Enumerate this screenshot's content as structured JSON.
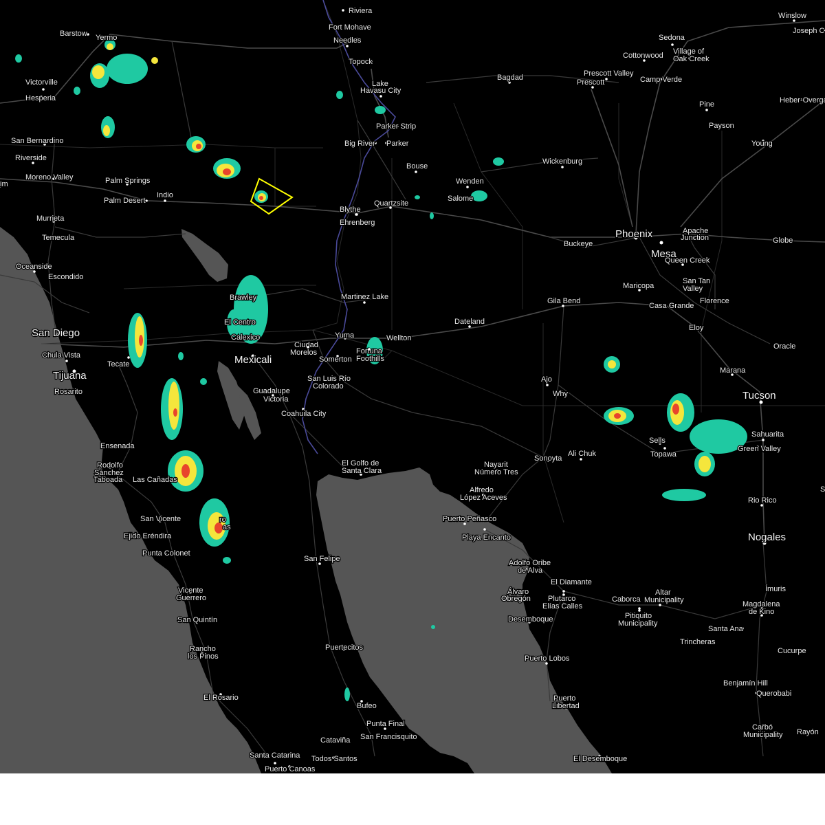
{
  "map": {
    "colors": {
      "land": "#000000",
      "water": "#555555",
      "road": "#3a3a3a",
      "river": "#4a4a9a",
      "warning_polygon": "#ffff00",
      "radar_light": "#1fc9a2",
      "radar_moderate": "#f5e63c",
      "radar_heavy": "#e8452c",
      "footer": "#ffffff"
    },
    "cities": [
      {
        "name": "Riviera",
        "major": false
      },
      {
        "name": "Fort Mohave",
        "major": false
      },
      {
        "name": "Needles",
        "major": false
      },
      {
        "name": "Topock",
        "major": false
      },
      {
        "name": "Lake",
        "major": false
      },
      {
        "name": "Havasu City",
        "major": false
      },
      {
        "name": "Parker Strip",
        "major": false
      },
      {
        "name": "Big River",
        "major": false
      },
      {
        "name": "Parker",
        "major": false
      },
      {
        "name": "Bouse",
        "major": false
      },
      {
        "name": "Quartzsite",
        "major": false
      },
      {
        "name": "Blythe",
        "major": false
      },
      {
        "name": "Ehrenberg",
        "major": false
      },
      {
        "name": "Barstow",
        "major": false
      },
      {
        "name": "Yermo",
        "major": false
      },
      {
        "name": "Victorville",
        "major": false
      },
      {
        "name": "Hesperia",
        "major": false
      },
      {
        "name": "San Bernardino",
        "major": false
      },
      {
        "name": "Riverside",
        "major": false
      },
      {
        "name": "Moreno Valley",
        "major": false
      },
      {
        "name": "im",
        "major": false
      },
      {
        "name": "Palm Springs",
        "major": false
      },
      {
        "name": "Palm Desert",
        "major": false
      },
      {
        "name": "Indio",
        "major": false
      },
      {
        "name": "Murrieta",
        "major": false
      },
      {
        "name": "Temecula",
        "major": false
      },
      {
        "name": "Oceanside",
        "major": false
      },
      {
        "name": "Escondido",
        "major": false
      },
      {
        "name": "San Diego",
        "major": true
      },
      {
        "name": "Chula Vista",
        "major": false
      },
      {
        "name": "Tijuana",
        "major": true
      },
      {
        "name": "Tecate",
        "major": false
      },
      {
        "name": "Rosarito",
        "major": false
      },
      {
        "name": "Ensenada",
        "major": false
      },
      {
        "name": "Rodolfo",
        "major": false
      },
      {
        "name": "Sánchez",
        "major": false
      },
      {
        "name": "Taboada",
        "major": false
      },
      {
        "name": "Las Cañadas",
        "major": false
      },
      {
        "name": "San Vicente",
        "major": false
      },
      {
        "name": "Ejido Eréndira",
        "major": false
      },
      {
        "name": "Punta Colonet",
        "major": false
      },
      {
        "name": "Vicente",
        "major": false
      },
      {
        "name": "Guerrero",
        "major": false
      },
      {
        "name": "San Quintín",
        "major": false
      },
      {
        "name": "Rancho",
        "major": false
      },
      {
        "name": "los Pinos",
        "major": false
      },
      {
        "name": "El Rosario",
        "major": false
      },
      {
        "name": "Brawley",
        "major": false
      },
      {
        "name": "El Centro",
        "major": false
      },
      {
        "name": "Calexico",
        "major": false
      },
      {
        "name": "Mexicali",
        "major": true
      },
      {
        "name": "Ciudad",
        "major": false
      },
      {
        "name": "Morelos",
        "major": false
      },
      {
        "name": "Yuma",
        "major": false
      },
      {
        "name": "Somerton",
        "major": false
      },
      {
        "name": "Fortuna",
        "major": false
      },
      {
        "name": "Foothills",
        "major": false
      },
      {
        "name": "Wellton",
        "major": false
      },
      {
        "name": "Martinez Lake",
        "major": false
      },
      {
        "name": "San Luis Río",
        "major": false
      },
      {
        "name": "Colorado",
        "major": false
      },
      {
        "name": "Guadalupe",
        "major": false
      },
      {
        "name": "Victoria",
        "major": false
      },
      {
        "name": "Coahuila City",
        "major": false
      },
      {
        "name": "El Golfo de",
        "major": false
      },
      {
        "name": "Santa Clara",
        "major": false
      },
      {
        "name": "San Felipe",
        "major": false
      },
      {
        "name": "Puertecitos",
        "major": false
      },
      {
        "name": "Bufeo",
        "major": false
      },
      {
        "name": "Punta Final",
        "major": false
      },
      {
        "name": "San Francisquito",
        "major": false
      },
      {
        "name": "Cataviña",
        "major": false
      },
      {
        "name": "Santa Catarina",
        "major": false
      },
      {
        "name": "Todos Santos",
        "major": false
      },
      {
        "name": "Puerto Canoas",
        "major": false
      },
      {
        "name": "Winslow",
        "major": false
      },
      {
        "name": "Joseph C",
        "major": false
      },
      {
        "name": "Sedona",
        "major": false
      },
      {
        "name": "Cottonwood",
        "major": false
      },
      {
        "name": "Village of",
        "major": false
      },
      {
        "name": "Oak Creek",
        "major": false
      },
      {
        "name": "Bagdad",
        "major": false
      },
      {
        "name": "Prescott Valley",
        "major": false
      },
      {
        "name": "Prescott",
        "major": false
      },
      {
        "name": "Camp Verde",
        "major": false
      },
      {
        "name": "Pine",
        "major": false
      },
      {
        "name": "Heber-Overga",
        "major": false
      },
      {
        "name": "Payson",
        "major": false
      },
      {
        "name": "Young",
        "major": false
      },
      {
        "name": "Wickenburg",
        "major": false
      },
      {
        "name": "Wenden",
        "major": false
      },
      {
        "name": "Salome",
        "major": false
      },
      {
        "name": "Phoenix",
        "major": true
      },
      {
        "name": "Apache",
        "major": false
      },
      {
        "name": "Junction",
        "major": false
      },
      {
        "name": "Mesa",
        "major": true
      },
      {
        "name": "Globe",
        "major": false
      },
      {
        "name": "Buckeye",
        "major": false
      },
      {
        "name": "Queen Creek",
        "major": false
      },
      {
        "name": "Maricopa",
        "major": false
      },
      {
        "name": "San Tan",
        "major": false
      },
      {
        "name": "Valley",
        "major": false
      },
      {
        "name": "Florence",
        "major": false
      },
      {
        "name": "Casa Grande",
        "major": false
      },
      {
        "name": "Gila Bend",
        "major": false
      },
      {
        "name": "Eloy",
        "major": false
      },
      {
        "name": "Dateland",
        "major": false
      },
      {
        "name": "Oracle",
        "major": false
      },
      {
        "name": "Marana",
        "major": false
      },
      {
        "name": "Tucson",
        "major": true
      },
      {
        "name": "Ajo",
        "major": false
      },
      {
        "name": "Why",
        "major": false
      },
      {
        "name": "Sells",
        "major": false
      },
      {
        "name": "Topawa",
        "major": false
      },
      {
        "name": "Sahuarita",
        "major": false
      },
      {
        "name": "Green Valley",
        "major": false
      },
      {
        "name": "Ali Chuk",
        "major": false
      },
      {
        "name": "Sonoyta",
        "major": false
      },
      {
        "name": "Rio Rico",
        "major": false
      },
      {
        "name": "Nogales",
        "major": true
      },
      {
        "name": "Nayarit",
        "major": false
      },
      {
        "name": "Número Tres",
        "major": false
      },
      {
        "name": "Alfredo",
        "major": false
      },
      {
        "name": "López Aceves",
        "major": false
      },
      {
        "name": "Puerto Peñasco",
        "major": false
      },
      {
        "name": "Playa Encanto",
        "major": false
      },
      {
        "name": "Adolfo Oribe",
        "major": false
      },
      {
        "name": "de Alva",
        "major": false
      },
      {
        "name": "El Diamante",
        "major": false
      },
      {
        "name": "Álvaro",
        "major": false
      },
      {
        "name": "Obregón",
        "major": false
      },
      {
        "name": "Plutarco",
        "major": false
      },
      {
        "name": "Elías Calles",
        "major": false
      },
      {
        "name": "Caborca",
        "major": false
      },
      {
        "name": "Altar",
        "major": false
      },
      {
        "name": "Municipality",
        "major": false
      },
      {
        "name": "Pitiquito",
        "major": false
      },
      {
        "name": "Municipality",
        "major": false
      },
      {
        "name": "Desemboque",
        "major": false
      },
      {
        "name": "Santa Ana",
        "major": false
      },
      {
        "name": "Trincheras",
        "major": false
      },
      {
        "name": "Ímuris",
        "major": false
      },
      {
        "name": "Magdalena",
        "major": false
      },
      {
        "name": "de Kino",
        "major": false
      },
      {
        "name": "Cucurpe",
        "major": false
      },
      {
        "name": "Puerto Lobos",
        "major": false
      },
      {
        "name": "Benjamín Hill",
        "major": false
      },
      {
        "name": "Querobabi",
        "major": false
      },
      {
        "name": "Puerto",
        "major": false
      },
      {
        "name": "Libertad",
        "major": false
      },
      {
        "name": "Carbó",
        "major": false
      },
      {
        "name": "Municipality",
        "major": false
      },
      {
        "name": "Rayón",
        "major": false
      },
      {
        "name": "El Desemboque",
        "major": false
      },
      {
        "name": "ro",
        "major": false
      },
      {
        "name": "as",
        "major": false
      },
      {
        "name": "S",
        "major": false
      }
    ]
  }
}
